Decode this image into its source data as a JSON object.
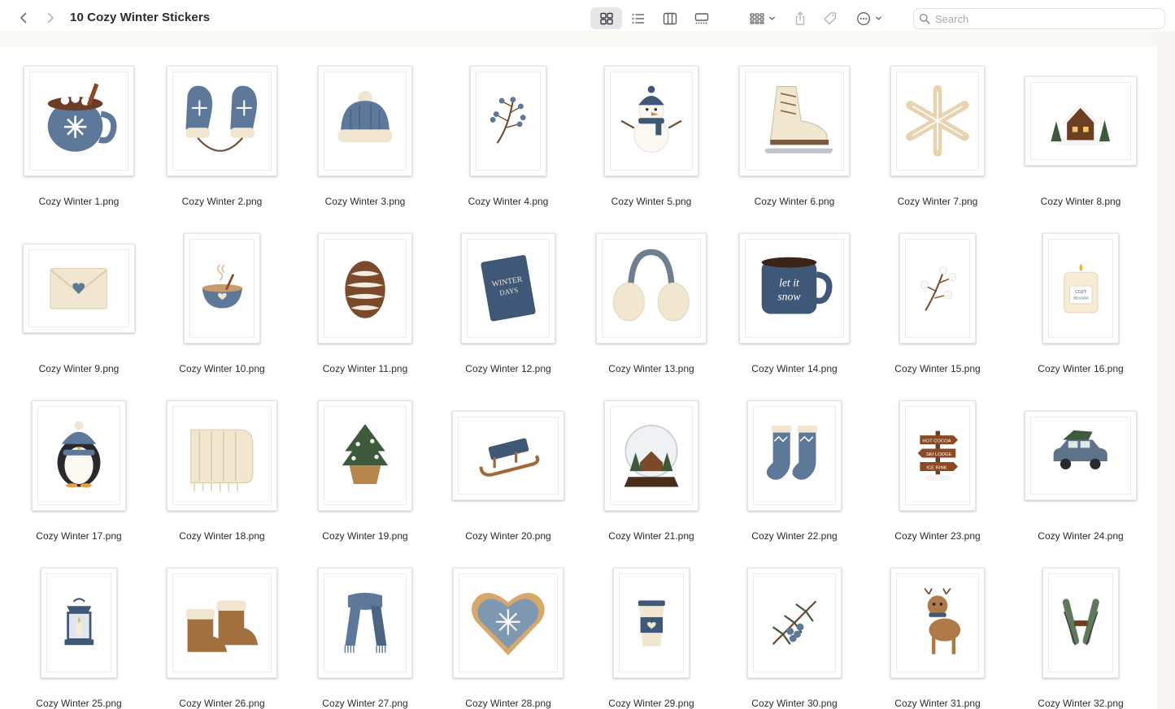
{
  "window": {
    "title": "10 Cozy Winter Stickers"
  },
  "toolbar": {
    "views": [
      "grid-view-icon",
      "list-view-icon",
      "columns-view-icon",
      "gallery-view-icon"
    ],
    "active_view": "grid-view-icon"
  },
  "search": {
    "placeholder": "Search",
    "value": ""
  },
  "files": [
    {
      "name": "Cozy Winter 1.png",
      "motif": "cocoa-mug",
      "aspect": "landscape"
    },
    {
      "name": "Cozy Winter 2.png",
      "motif": "mittens",
      "aspect": "landscape"
    },
    {
      "name": "Cozy Winter 3.png",
      "motif": "beanie",
      "aspect": "portrait"
    },
    {
      "name": "Cozy Winter 4.png",
      "motif": "berry-branch",
      "aspect": "tall"
    },
    {
      "name": "Cozy Winter 5.png",
      "motif": "snowman",
      "aspect": "portrait"
    },
    {
      "name": "Cozy Winter 6.png",
      "motif": "ice-skate",
      "aspect": "landscape"
    },
    {
      "name": "Cozy Winter 7.png",
      "motif": "snowflake",
      "aspect": "portrait"
    },
    {
      "name": "Cozy Winter 8.png",
      "motif": "cabin",
      "aspect": "wide"
    },
    {
      "name": "Cozy Winter 9.png",
      "motif": "envelope",
      "aspect": "wide"
    },
    {
      "name": "Cozy Winter 10.png",
      "motif": "cocoa-bowl",
      "aspect": "tall"
    },
    {
      "name": "Cozy Winter 11.png",
      "motif": "pinecone",
      "aspect": "portrait"
    },
    {
      "name": "Cozy Winter 12.png",
      "motif": "book",
      "aspect": "portrait"
    },
    {
      "name": "Cozy Winter 13.png",
      "motif": "earmuffs",
      "aspect": "landscape"
    },
    {
      "name": "Cozy Winter 14.png",
      "motif": "snow-mug",
      "aspect": "landscape"
    },
    {
      "name": "Cozy Winter 15.png",
      "motif": "cotton-branch",
      "aspect": "tall"
    },
    {
      "name": "Cozy Winter 16.png",
      "motif": "candle",
      "aspect": "tall"
    },
    {
      "name": "Cozy Winter 17.png",
      "motif": "penguin",
      "aspect": "portrait"
    },
    {
      "name": "Cozy Winter 18.png",
      "motif": "blanket",
      "aspect": "landscape"
    },
    {
      "name": "Cozy Winter 19.png",
      "motif": "tree-basket",
      "aspect": "portrait"
    },
    {
      "name": "Cozy Winter 20.png",
      "motif": "sled",
      "aspect": "wide"
    },
    {
      "name": "Cozy Winter 21.png",
      "motif": "snow-globe",
      "aspect": "portrait"
    },
    {
      "name": "Cozy Winter 22.png",
      "motif": "socks",
      "aspect": "portrait"
    },
    {
      "name": "Cozy Winter 23.png",
      "motif": "signpost",
      "aspect": "tall"
    },
    {
      "name": "Cozy Winter 24.png",
      "motif": "car",
      "aspect": "wide"
    },
    {
      "name": "Cozy Winter 25.png",
      "motif": "lantern",
      "aspect": "tall"
    },
    {
      "name": "Cozy Winter 26.png",
      "motif": "boots",
      "aspect": "landscape"
    },
    {
      "name": "Cozy Winter 27.png",
      "motif": "scarf",
      "aspect": "portrait"
    },
    {
      "name": "Cozy Winter 28.png",
      "motif": "heart-cookie",
      "aspect": "landscape"
    },
    {
      "name": "Cozy Winter 29.png",
      "motif": "coffee-cup",
      "aspect": "tall"
    },
    {
      "name": "Cozy Winter 30.png",
      "motif": "pine-berries",
      "aspect": "portrait"
    },
    {
      "name": "Cozy Winter 31.png",
      "motif": "deer",
      "aspect": "portrait"
    },
    {
      "name": "Cozy Winter 32.png",
      "motif": "skis",
      "aspect": "tall"
    }
  ],
  "sticker_text": {
    "book_line1": "WINTER",
    "book_line2": "DAYS",
    "mug_line1": "let it",
    "mug_line2": "snow",
    "candle_line1": "COZY",
    "candle_line2": "SEASON",
    "sign_1": "HOT COCOA",
    "sign_2": "SKI LODGE",
    "sign_3": "ICE RINK"
  },
  "colors": {
    "navy": "#3f5878",
    "slate_blue": "#5d7898",
    "cream": "#f1e6cf",
    "brown": "#8a5a35",
    "green": "#3d5a3a",
    "accent_selected": "#e6e6e8"
  }
}
